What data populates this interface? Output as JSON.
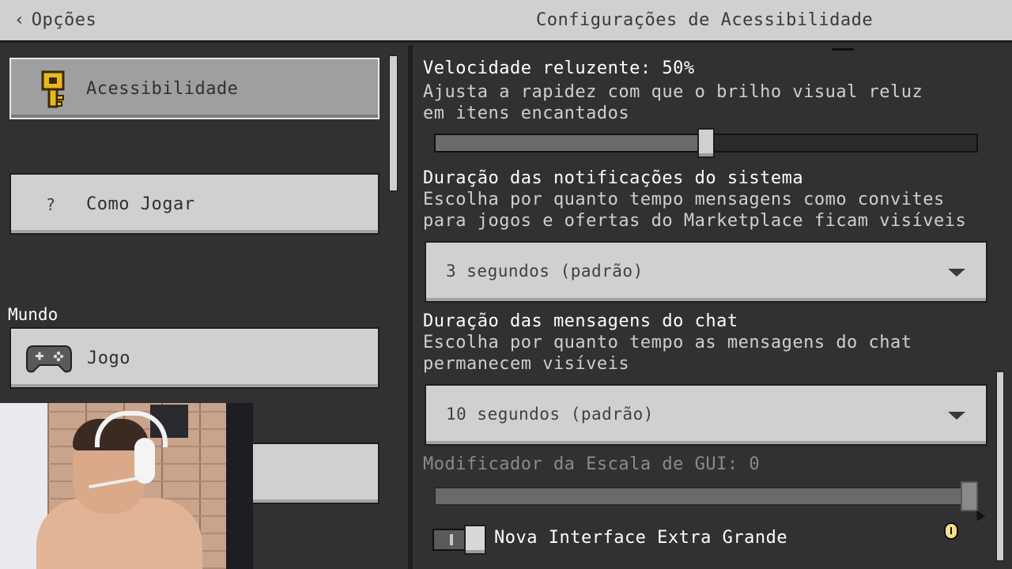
{
  "header": {
    "back_label": "Opções",
    "title": "Configurações de Acessibilidade"
  },
  "sidebar": {
    "items": [
      {
        "label": "Acessibilidade",
        "icon": "key-icon",
        "selected": true
      },
      {
        "label": "Como Jogar",
        "icon": "question-icon",
        "icon_text": "?",
        "selected": false
      }
    ],
    "section_label": "Mundo",
    "world_items": [
      {
        "label": "Jogo",
        "icon": "controller-icon",
        "selected": false
      }
    ]
  },
  "settings": {
    "glint_speed": {
      "title": "Velocidade reluzente: 50%",
      "description_line1": "Ajusta a rapidez com que o brilho visual reluz",
      "description_line2": "em itens encantados",
      "value_percent": 50
    },
    "notification_duration": {
      "title": "Duração das notificações do sistema",
      "description_line1": "Escolha por quanto tempo mensagens como convites",
      "description_line2": "para jogos e ofertas do Marketplace ficam visíveis",
      "selected": "3 segundos (padrão)"
    },
    "chat_duration": {
      "title": "Duração das mensagens do chat",
      "description_line1": "Escolha por quanto tempo as mensagens do chat",
      "description_line2": "permanecem visíveis",
      "selected": "10 segundos (padrão)"
    },
    "gui_scale": {
      "title": "Modificador da Escala de GUI: 0",
      "value_fraction": 1.0,
      "enabled": false
    },
    "extra_large_ui": {
      "label": "Nova Interface Extra Grande",
      "enabled": true
    }
  },
  "colors": {
    "background": "#313131",
    "button": "#d0d0d0",
    "button_selected": "#9f9f9f",
    "text_light": "#ffffff",
    "text_dim": "#8a8a8a"
  }
}
